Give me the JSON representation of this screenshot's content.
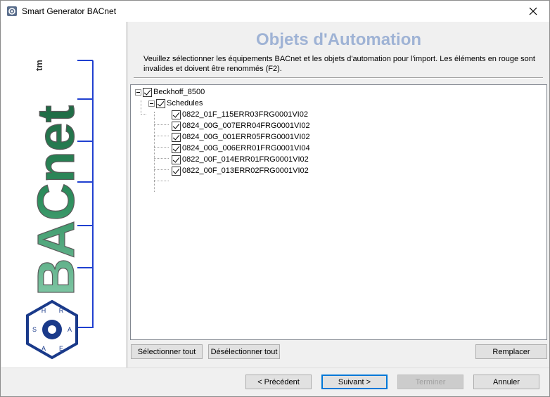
{
  "window": {
    "title": "Smart Generator BACnet"
  },
  "page": {
    "title": "Objets d'Automation",
    "instructions": "Veuillez sélectionner les équipements BACnet et les objets d'automation pour l'import. Les éléments en rouge sont invalides et doivent être renommés (F2)."
  },
  "logo": {
    "text": "BACnet",
    "tm": "tm",
    "seal_letters": [
      "H",
      "R",
      "A",
      "E",
      "A",
      "S"
    ]
  },
  "tree": {
    "root": {
      "label": "Beckhoff_8500",
      "checked": true
    },
    "group": {
      "label": "Schedules",
      "checked": true
    },
    "items": [
      {
        "label": "0822_01F_115ERR03FRG0001VI02",
        "checked": true
      },
      {
        "label": "0824_00G_007ERR04FRG0001VI02",
        "checked": true
      },
      {
        "label": "0824_00G_001ERR05FRG0001VI02",
        "checked": true
      },
      {
        "label": "0824_00G_006ERR01FRG0001VI04",
        "checked": true
      },
      {
        "label": "0822_00F_014ERR01FRG0001VI02",
        "checked": true
      },
      {
        "label": "0822_00F_013ERR02FRG0001VI02",
        "checked": true
      }
    ]
  },
  "buttons": {
    "select_all": "Sélectionner tout",
    "deselect_all": "Désélectionner tout",
    "replace": "Remplacer",
    "previous": "< Précédent",
    "next": "Suivant >",
    "finish": "Terminer",
    "cancel": "Annuler"
  },
  "colors": {
    "title": "#9fb3d5",
    "accent": "#0078d7"
  }
}
